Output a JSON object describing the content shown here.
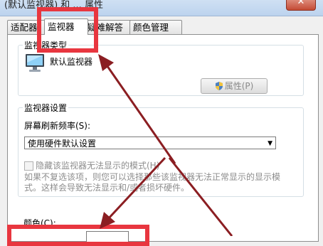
{
  "window": {
    "title": "(默认监视器) 和 ... 属性",
    "close_glyph": "✕"
  },
  "tabs": [
    {
      "label": "适配器"
    },
    {
      "label": "监视器"
    },
    {
      "label": "疑难解答"
    },
    {
      "label": "颜色管理"
    }
  ],
  "monitor_type": {
    "group_title": "监视器类型",
    "name": "默认监视器",
    "properties_button": "属性(P)"
  },
  "monitor_settings": {
    "group_title": "监视器设置",
    "refresh_label": "屏幕刷新频率(S):",
    "refresh_value": "使用硬件默认设置",
    "hide_modes_label": "隐藏该监视器无法显示的模式(H)",
    "hide_modes_description": "如果不复选该项，则您可以选择那些该监视器无法正常显示的显示模式。这样会导致无法显示和/或者损坏硬件。"
  },
  "colors": {
    "group_title": "颜色(C):"
  },
  "annotation": {
    "highlight_color": "#e8363f",
    "arrow_color": "#8b1e22"
  }
}
